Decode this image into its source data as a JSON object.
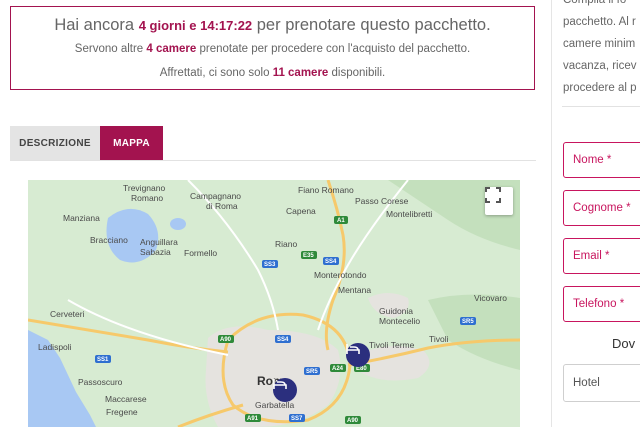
{
  "alert": {
    "line1_prefix": "Hai ancora ",
    "line1_days": "4 giorni",
    "line1_and": " e ",
    "line1_time": "14:17:22",
    "line1_suffix": " per prenotare questo pacchetto.",
    "line2_prefix": "Servono altre ",
    "line2_count": "4 camere",
    "line2_suffix": " prenotate per procedere con l'acquisto del pacchetto.",
    "line3_prefix": "Affrettati, ci sono solo ",
    "line3_count": "11 camere",
    "line3_suffix": " disponibili."
  },
  "tabs": [
    {
      "label": "DESCRIZIONE",
      "active": false
    },
    {
      "label": "MAPPA",
      "active": true
    }
  ],
  "map": {
    "place_labels": {
      "trevignano": "Trevignano",
      "romano": "Romano",
      "manziana": "Manziana",
      "bracciano": "Bracciano",
      "anguillara": "Anguillara",
      "sabazia": "Sabazia",
      "campagnano": "Campagnano",
      "di_roma": "di Roma",
      "formello": "Formello",
      "fiano": "Fiano Romano",
      "capena": "Capena",
      "passo_corese": "Passo Corese",
      "montelibretti": "Montelibretti",
      "riano": "Riano",
      "monterotondo": "Monterotondo",
      "mentana": "Mentana",
      "guidonia": "Guidonia",
      "montecelio": "Montecelio",
      "vicovaro": "Vicovaro",
      "cerveteri": "Cerveteri",
      "ladispoli": "Ladispoli",
      "tivoli_terme": "Tivoli Terme",
      "tivoli": "Tivoli",
      "roma": "Roma",
      "passoscuro": "Passoscuro",
      "maccarese": "Maccarese",
      "fregene": "Fregene",
      "garbatella": "Garbatella"
    },
    "road_labels": {
      "a1": "A1",
      "e35": "E35",
      "ss3": "SS3",
      "ss4": "SS4",
      "ss4b": "SS4",
      "a90": "A90",
      "ss1": "SS1",
      "sr5": "SR5",
      "sr5b": "SR5",
      "a24": "A24",
      "e80": "E80",
      "a91": "A91",
      "ss7": "SS7",
      "a90b": "A90"
    },
    "colors": {
      "land": "#d7ebd2",
      "water": "#a8c8f3",
      "urban": "#e5e3df",
      "highway": "#f6c96b",
      "road_shield": "#2f6fd0",
      "pin": "#2b2f7e"
    }
  },
  "sidebar": {
    "text_lines": [
      "Compila il fo",
      "pacchetto. Al r",
      "camere minim",
      "vacanza, ricev",
      "procedere al p"
    ],
    "fields": [
      {
        "label": "Nome",
        "required": "*"
      },
      {
        "label": "Cognome",
        "required": "*"
      },
      {
        "label": "Email",
        "required": "*"
      },
      {
        "label": "Telefono",
        "required": "*"
      }
    ],
    "dove_label": "Dov",
    "hotel_select": "Hotel"
  }
}
